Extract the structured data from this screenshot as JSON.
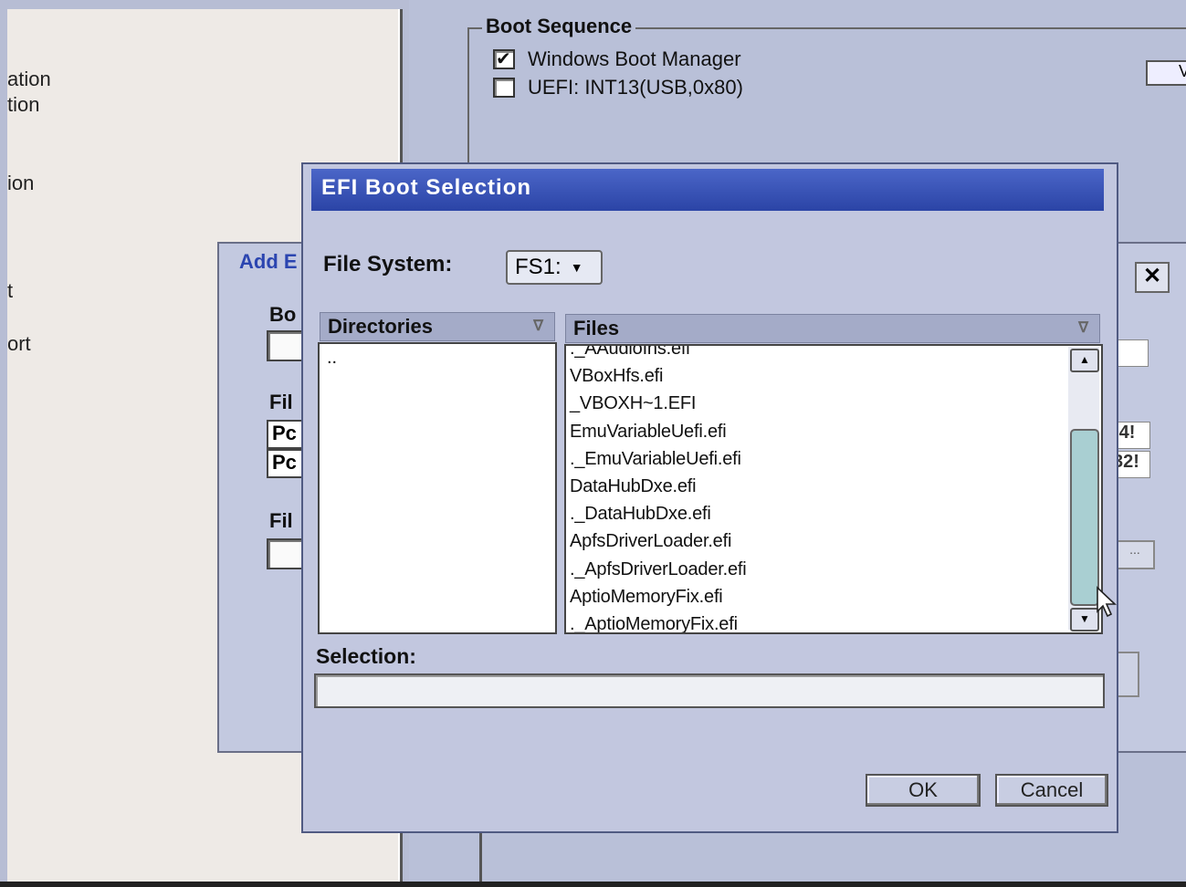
{
  "background": {
    "nav_items": [
      "ation",
      "tion",
      "ion",
      "t",
      "ort"
    ],
    "boot_sequence": {
      "title": "Boot Sequence",
      "options": [
        {
          "label": "Windows Boot Manager",
          "checked": true
        },
        {
          "label": "UEFI: INT13(USB,0x80)",
          "checked": false
        }
      ],
      "top_right_button": "V"
    }
  },
  "add_dialog": {
    "title": "Add E",
    "close_label": "✕",
    "label_boot": "Bo",
    "label_file1": "Fil",
    "label_file2": "Fil",
    "value_rows": [
      "Pc",
      "Pc"
    ],
    "right_fragments": [
      "-4!",
      "32!"
    ],
    "browse_label": "..."
  },
  "efi_dialog": {
    "title": "EFI Boot Selection",
    "file_system_label": "File System:",
    "file_system_value": "FS1:",
    "directories_header": "Directories",
    "files_header": "Files",
    "directories": [
      ".."
    ],
    "files": [
      "._AAudioIns.efi",
      "VBoxHfs.efi",
      "_VBOXH~1.EFI",
      "EmuVariableUefi.efi",
      "._EmuVariableUefi.efi",
      "DataHubDxe.efi",
      "._DataHubDxe.efi",
      "ApfsDriverLoader.efi",
      "._ApfsDriverLoader.efi",
      "AptioMemoryFix.efi",
      "._AptioMemoryFix.efi"
    ],
    "selection_label": "Selection:",
    "selection_value": "",
    "ok_label": "OK",
    "cancel_label": "Cancel"
  },
  "icons": {
    "sort": "sort-icon",
    "dropdown": "chevron-down-icon",
    "scroll_up": "arrow-up-icon",
    "scroll_down": "arrow-down-icon",
    "checkbox": "checkbox-icon",
    "close": "close-icon",
    "cursor": "mouse-pointer-icon"
  }
}
